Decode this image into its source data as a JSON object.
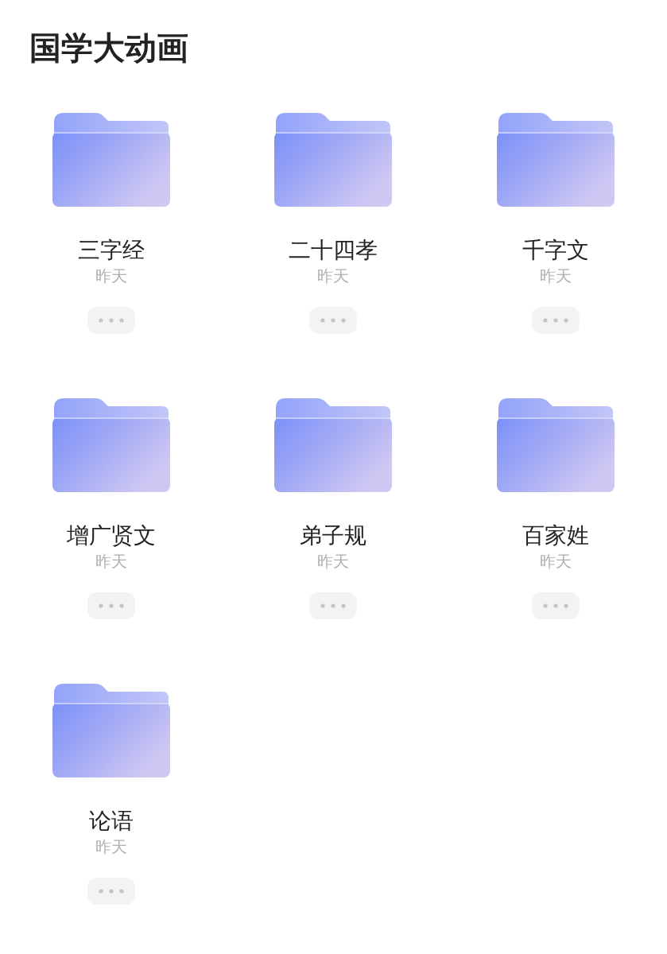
{
  "title": "国学大动画",
  "folders": [
    {
      "name": "三字经",
      "date": "昨天"
    },
    {
      "name": "二十四孝",
      "date": "昨天"
    },
    {
      "name": "千字文",
      "date": "昨天"
    },
    {
      "name": "增广贤文",
      "date": "昨天"
    },
    {
      "name": "弟子规",
      "date": "昨天"
    },
    {
      "name": "百家姓",
      "date": "昨天"
    },
    {
      "name": "论语",
      "date": "昨天"
    }
  ]
}
